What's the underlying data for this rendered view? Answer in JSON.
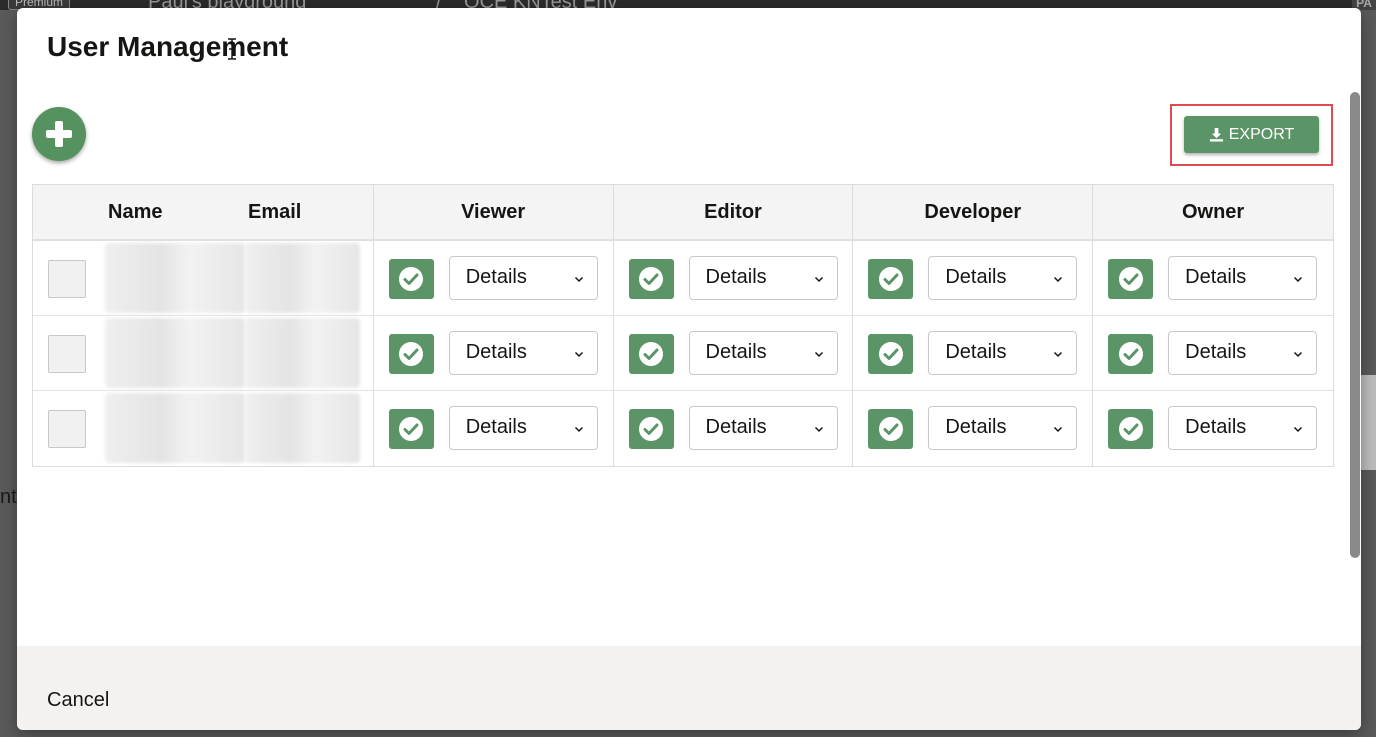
{
  "background": {
    "badge": "Premium",
    "breadcrumb_1": "Paul's playground",
    "breadcrumb_separator": "/",
    "breadcrumb_2": "OCE KNTest Env",
    "user_badge": "PA",
    "left_text_fragment": "nt"
  },
  "modal": {
    "title": "User Management",
    "export_label": "EXPORT",
    "cancel_label": "Cancel"
  },
  "table": {
    "headers": {
      "name": "Name",
      "email": "Email",
      "roles": [
        "Viewer",
        "Editor",
        "Developer",
        "Owner"
      ]
    },
    "rows": [
      {
        "name": "",
        "email": "",
        "roles": [
          "Details",
          "Details",
          "Details",
          "Details"
        ]
      },
      {
        "name": "",
        "email": "",
        "roles": [
          "Details",
          "Details",
          "Details",
          "Details"
        ]
      },
      {
        "name": "",
        "email": "",
        "roles": [
          "Details",
          "Details",
          "Details",
          "Details"
        ]
      }
    ]
  },
  "colors": {
    "accent_green": "#5b9466",
    "highlight_red": "#e04b4f"
  },
  "icons": [
    "plus-icon",
    "download-icon",
    "check-circle-icon",
    "chevron-down-icon",
    "text-cursor-icon"
  ]
}
